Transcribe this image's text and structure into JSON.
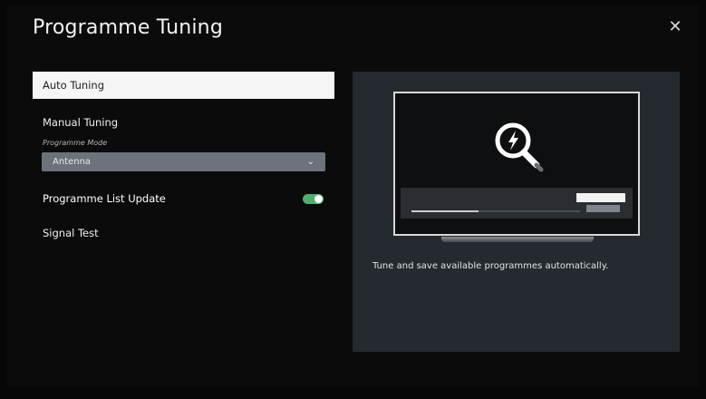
{
  "header": {
    "title": "Programme Tuning",
    "close_icon": "close-icon"
  },
  "menu": {
    "auto_tuning": "Auto Tuning",
    "manual_tuning": "Manual Tuning",
    "programme_mode_label": "Programme Mode",
    "programme_mode_value": "Antenna",
    "programme_list_update": "Programme List Update",
    "programme_list_update_on": true,
    "signal_test": "Signal Test"
  },
  "panel": {
    "description": "Tune and save available programmes automatically.",
    "illustration_icon": "search-lightning-icon",
    "progress": 0.4
  },
  "colors": {
    "background": "#0b0b0b",
    "panel": "#242a2f",
    "selected_item": "#f5f5f5",
    "toggle_on": "#4fae6b",
    "select_bg": "#6c737b"
  }
}
